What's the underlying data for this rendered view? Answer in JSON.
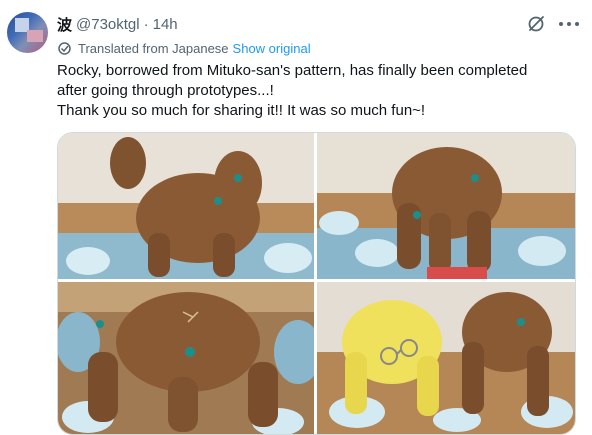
{
  "tweet": {
    "display_name": "波",
    "handle": "@73oktgl",
    "separator": "·",
    "time": "14h",
    "translated_label": "Translated from Japanese",
    "show_original": "Show original",
    "text_lines": [
      "Rocky, borrowed from Mituko-san's pattern, has finally been completed",
      "after going through prototypes...!",
      "Thank you so much for sharing it!! It was so much fun~!"
    ]
  },
  "icons": {
    "grok": "grok-icon",
    "more": "more-icon",
    "translate": "translate-icon"
  },
  "colors": {
    "link": "#1d9bf0",
    "secondary_text": "#536471",
    "plush": "#8a5a35",
    "plush_yellow": "#efe15c",
    "stitch": "#1d8f8a"
  }
}
